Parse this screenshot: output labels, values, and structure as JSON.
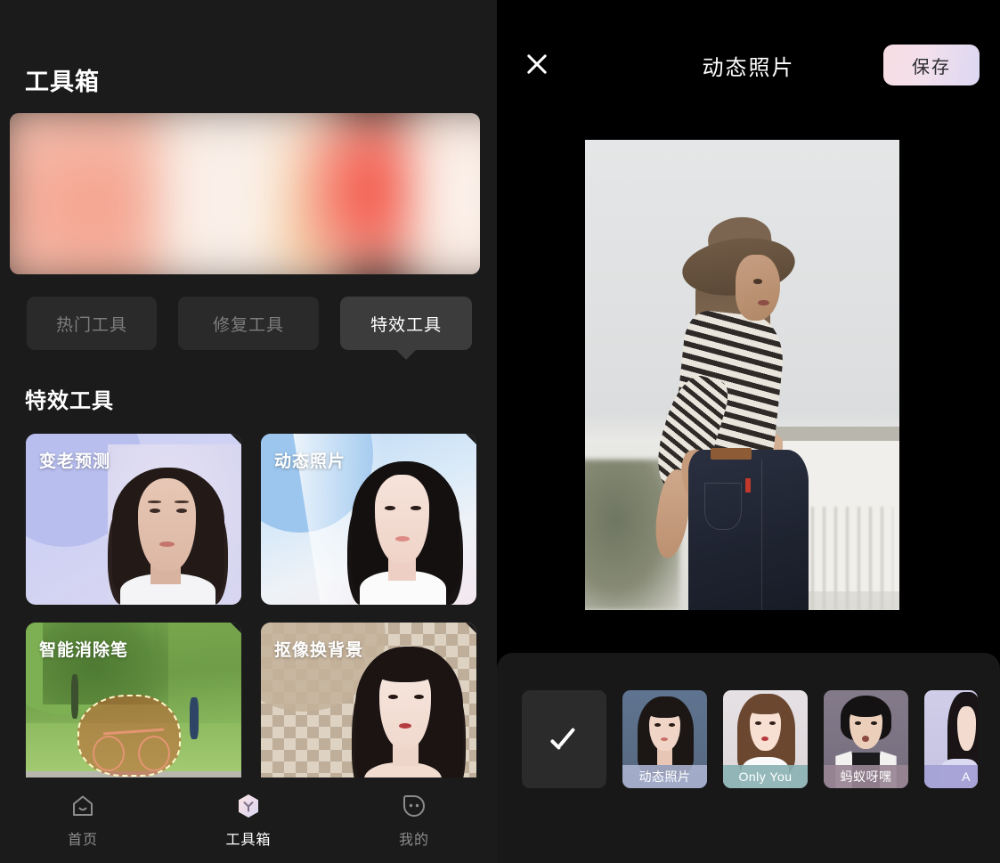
{
  "left_panel": {
    "title": "工具箱",
    "banner": {
      "name": "promo-banner"
    },
    "tabs": [
      {
        "label": "热门工具",
        "active": false
      },
      {
        "label": "修复工具",
        "active": false
      },
      {
        "label": "特效工具",
        "active": true
      }
    ],
    "section_title": "特效工具",
    "cards": [
      {
        "label": "变老预测"
      },
      {
        "label": "动态照片"
      },
      {
        "label": "智能消除笔"
      },
      {
        "label": "抠像换背景"
      }
    ],
    "bottom_nav": [
      {
        "label": "首页",
        "icon": "home-icon",
        "active": false
      },
      {
        "label": "工具箱",
        "icon": "toolbox-hexagon-icon",
        "active": true
      },
      {
        "label": "我的",
        "icon": "profile-icon",
        "active": false
      }
    ]
  },
  "right_panel": {
    "header": {
      "close_icon": "close-icon",
      "title": "动态照片",
      "save_label": "保存"
    },
    "preview": {
      "name": "preview-photo"
    },
    "thumbnails": [
      {
        "label": "",
        "icon": "check-icon",
        "selected": true
      },
      {
        "label": "动态照片",
        "selected": false
      },
      {
        "label": "Only You",
        "selected": false
      },
      {
        "label": "蚂蚁呀嘿",
        "selected": false
      },
      {
        "label": "A",
        "selected": false
      }
    ]
  },
  "colors": {
    "left_bg": "#1b1b1b",
    "right_bg": "#000000",
    "panel_bg": "#181818",
    "tab_inactive_bg": "#2a2a2a",
    "tab_active_bg": "#3c3c3c",
    "tab_inactive_text": "#7d7d7d",
    "save_gradient_start": "#f8dde3",
    "save_gradient_end": "#dcd7f2",
    "nav_inactive": "#8c8c8c",
    "nav_active": "#ffffff"
  }
}
